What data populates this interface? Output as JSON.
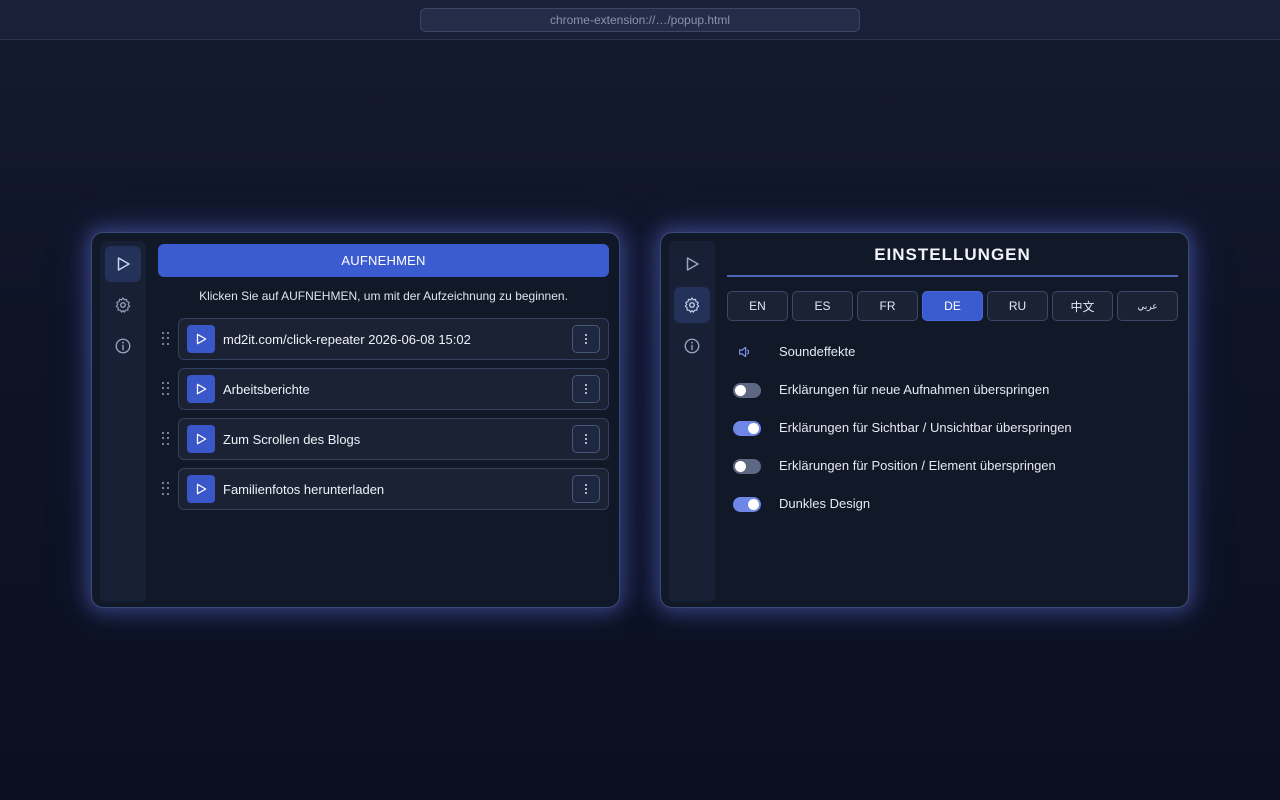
{
  "browser": {
    "url": "chrome-extension://…/popup.html"
  },
  "recorder": {
    "record_label": "AUFNEHMEN",
    "hint": "Klicken Sie auf AUFNEHMEN, um mit der Aufzeichnung zu beginnen.",
    "recordings": [
      {
        "name": "md2it.com/click-repeater 2026-06-08 15:02"
      },
      {
        "name": "Arbeitsberichte"
      },
      {
        "name": "Zum Scrollen des Blogs"
      },
      {
        "name": "Familienfotos herunterladen"
      }
    ]
  },
  "nav": {
    "items": [
      "play-icon",
      "gear-icon",
      "info-icon"
    ]
  },
  "settings": {
    "title": "EINSTELLUNGEN",
    "languages": [
      "EN",
      "ES",
      "FR",
      "DE",
      "RU",
      "中文",
      "عربي"
    ],
    "active_language": "DE",
    "options": [
      {
        "label": "Soundeffekte",
        "type": "icon",
        "icon": "speaker-icon"
      },
      {
        "label": "Erklärungen für neue Aufnahmen überspringen",
        "type": "toggle",
        "on": false
      },
      {
        "label": "Erklärungen für Sichtbar / Unsichtbar überspringen",
        "type": "toggle",
        "on": true
      },
      {
        "label": "Erklärungen für Position / Element überspringen",
        "type": "toggle",
        "on": false
      },
      {
        "label": "Dunkles Design",
        "type": "toggle",
        "on": true
      }
    ]
  },
  "colors": {
    "accent": "#3b5bd1",
    "background": "#0d1222",
    "panel": "#111827",
    "toggle_on": "#6e86e6",
    "toggle_off": "#5e6883"
  }
}
